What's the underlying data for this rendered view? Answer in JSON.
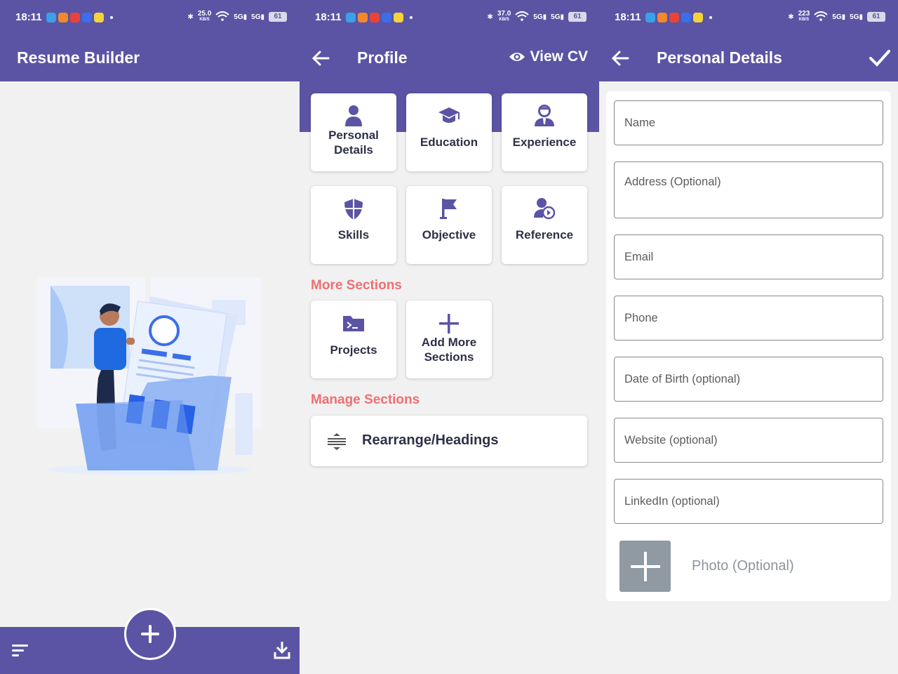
{
  "status": {
    "time": "18:11",
    "speeds": [
      {
        "value": "25.0",
        "unit": "KB/S"
      },
      {
        "value": "37.0",
        "unit": "KB/S"
      },
      {
        "value": "223",
        "unit": "KB/S"
      }
    ],
    "net1": "5G",
    "net2": "5G",
    "battery": "61"
  },
  "home": {
    "title": "Resume Builder"
  },
  "profile": {
    "title": "Profile",
    "view_cv": "View CV",
    "cards": [
      {
        "label": "Personal Details",
        "icon": "person-icon"
      },
      {
        "label": "Education",
        "icon": "graduation-cap-icon"
      },
      {
        "label": "Experience",
        "icon": "businessman-icon"
      },
      {
        "label": "Skills",
        "icon": "shield-icon"
      },
      {
        "label": "Objective",
        "icon": "flag-icon"
      },
      {
        "label": "Reference",
        "icon": "person-arrow-icon"
      }
    ],
    "more_sections_title": "More Sections",
    "more_cards": [
      {
        "label": "Projects",
        "icon": "folder-icon"
      },
      {
        "label": "Add More Sections",
        "icon": "plus-icon"
      }
    ],
    "manage_sections_title": "Manage Sections",
    "rearrange_label": "Rearrange/Headings"
  },
  "personal": {
    "title": "Personal Details",
    "fields": {
      "name": "Name",
      "address": "Address (Optional)",
      "email": "Email",
      "phone": "Phone",
      "dob": "Date of Birth (optional)",
      "website": "Website (optional)",
      "linkedin": "LinkedIn (optional)"
    },
    "photo_label": "Photo (Optional)"
  },
  "colors": {
    "primary": "#5b54a4",
    "accent": "#ef6f72",
    "background": "#f1f1f1"
  }
}
